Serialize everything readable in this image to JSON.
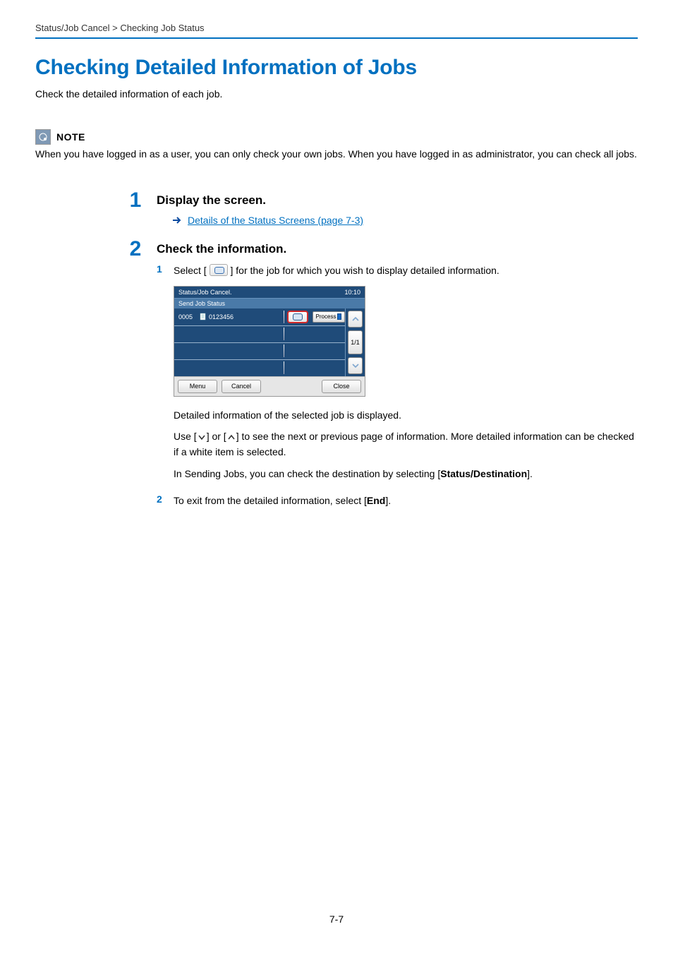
{
  "breadcrumb": "Status/Job Cancel > Checking Job Status",
  "title": "Checking Detailed Information of Jobs",
  "intro": "Check the detailed information of each job.",
  "note": {
    "label": "NOTE",
    "body": "When you have logged in as a user, you can only check your own jobs. When you have logged in as administrator, you can check all jobs."
  },
  "steps": {
    "s1": {
      "num": "1",
      "title": "Display the screen.",
      "link": "Details of the Status Screens (page 7-3)"
    },
    "s2": {
      "num": "2",
      "title": "Check the information.",
      "sub1": {
        "num": "1",
        "pre": "Select [",
        "post": "] for the job for which you wish to display detailed information."
      },
      "panel": {
        "header": "Status/Job Cancel.",
        "time": "10:10",
        "tab": "Send Job Status",
        "row1": {
          "id": "0005",
          "doc": "0123456",
          "status": "Process"
        },
        "pager": "1/1",
        "menu": "Menu",
        "cancel": "Cancel",
        "close": "Close"
      },
      "p_detail": "Detailed information of the selected job is displayed.",
      "p_nav_pre": "Use [",
      "p_nav_mid": "] or [",
      "p_nav_post": "] to see the next or previous page of information. More detailed information can be checked if a white item is selected.",
      "p_send_pre": "In Sending Jobs, you can check the destination by selecting [",
      "p_send_strong": "Status/Destination",
      "p_send_post": "].",
      "sub2": {
        "num": "2",
        "pre": "To exit from the detailed information, select [",
        "strong": "End",
        "post": "]."
      }
    }
  },
  "page_number": "7-7"
}
